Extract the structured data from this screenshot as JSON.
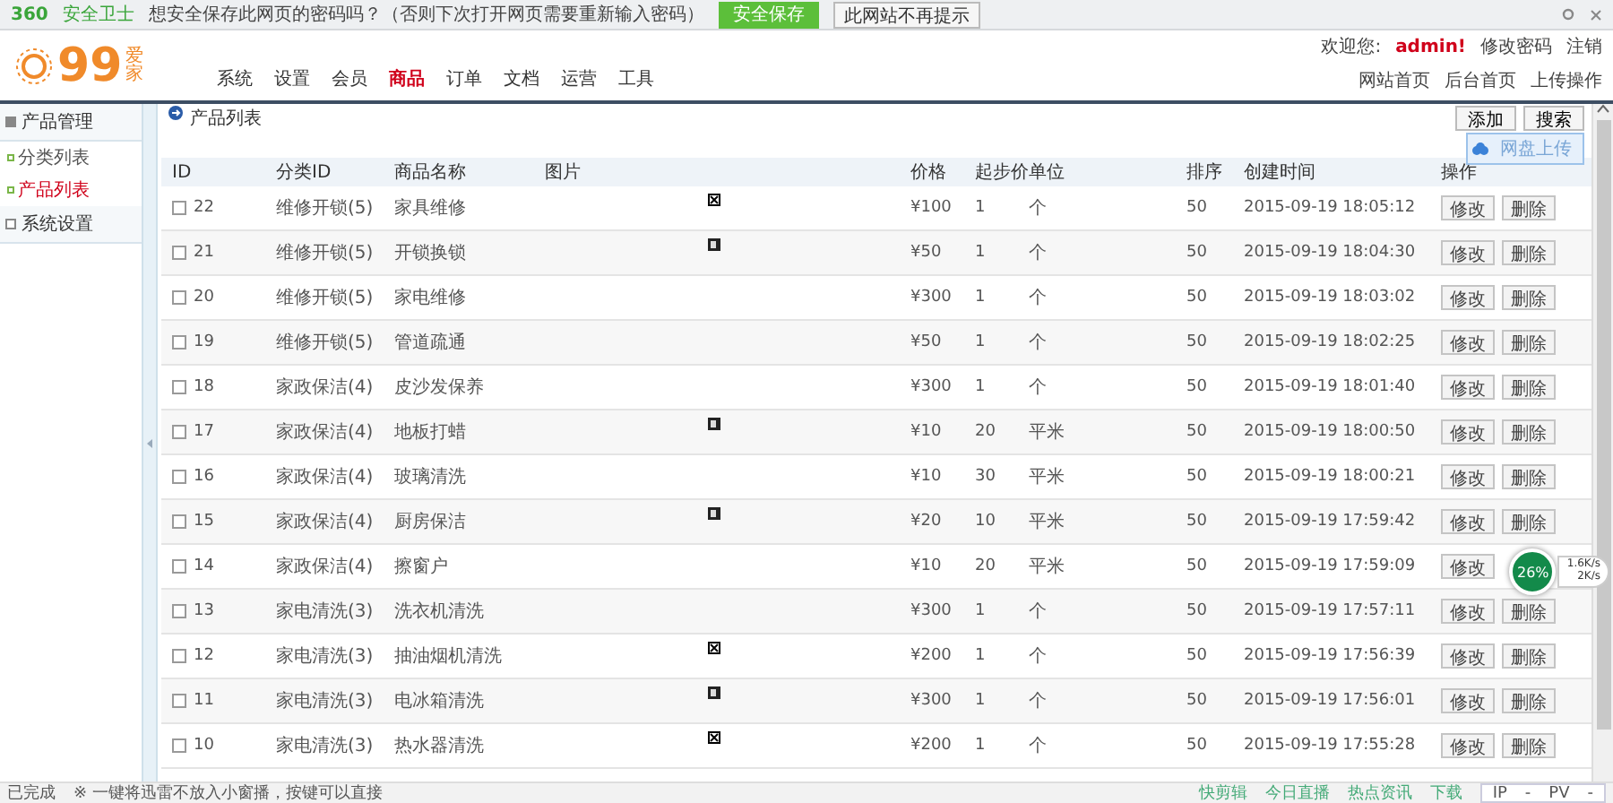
{
  "browser_bar": {
    "logo": "360",
    "logo_sub": "安全卫士",
    "prompt": "想安全保存此网页的密码吗？（否则下次打开网页需要重新输入密码）",
    "save_button": "安全保存",
    "dismiss_button": "此网站不再提示"
  },
  "header": {
    "logo_number": "99",
    "logo_text": "爱家",
    "nav": [
      {
        "label": "系统",
        "selected": false
      },
      {
        "label": "设置",
        "selected": false
      },
      {
        "label": "会员",
        "selected": false
      },
      {
        "label": "商品",
        "selected": true
      },
      {
        "label": "订单",
        "selected": false
      },
      {
        "label": "文档",
        "selected": false
      },
      {
        "label": "运营",
        "selected": false
      },
      {
        "label": "工具",
        "selected": false
      }
    ],
    "welcome": "欢迎您:",
    "user": "admin!",
    "user_links": [
      "修改密码",
      "注销"
    ],
    "quick_links": [
      "网站首页",
      "后台首页",
      "上传操作"
    ]
  },
  "sidebar": {
    "groups": [
      {
        "label": "产品管理",
        "expanded": true,
        "children": [
          {
            "label": "分类列表",
            "selected": false
          },
          {
            "label": "产品列表",
            "selected": true
          }
        ]
      },
      {
        "label": "系统设置",
        "expanded": false
      }
    ]
  },
  "page": {
    "title": "产品列表",
    "buttons": [
      "添加",
      "搜索"
    ],
    "upload_badge": "网盘上传"
  },
  "table": {
    "columns": [
      "ID",
      "分类ID",
      "商品名称",
      "图片",
      "价格",
      "起步价",
      "单位",
      "排序",
      "创建时间",
      "操作"
    ],
    "rows": [
      {
        "id": "22",
        "checked": false,
        "category": "维修开锁(5)",
        "name": "家具维修",
        "image": {
          "kind": "broken"
        },
        "price": "¥100",
        "start": "1",
        "unit": "个",
        "sort": "50",
        "created": "2015-09-19 18:05:12",
        "actions": [
          "修改",
          "删除"
        ]
      },
      {
        "id": "21",
        "checked": false,
        "category": "维修开锁(5)",
        "name": "开锁换锁",
        "image": {
          "kind": "photo"
        },
        "price": "¥50",
        "start": "1",
        "unit": "个",
        "sort": "50",
        "created": "2015-09-19 18:04:30",
        "actions": [
          "修改",
          "删除"
        ]
      },
      {
        "id": "20",
        "checked": false,
        "category": "维修开锁(5)",
        "name": "家电维修",
        "price": "¥300",
        "start": "1",
        "unit": "个",
        "sort": "50",
        "created": "2015-09-19 18:03:02",
        "actions": [
          "修改",
          "删除"
        ]
      },
      {
        "id": "19",
        "checked": false,
        "category": "维修开锁(5)",
        "name": "管道疏通",
        "price": "¥50",
        "start": "1",
        "unit": "个",
        "sort": "50",
        "created": "2015-09-19 18:02:25",
        "actions": [
          "修改",
          "删除"
        ]
      },
      {
        "id": "18",
        "checked": false,
        "category": "家政保洁(4)",
        "name": "皮沙发保养",
        "price": "¥300",
        "start": "1",
        "unit": "个",
        "sort": "50",
        "created": "2015-09-19 18:01:40",
        "actions": [
          "修改",
          "删除"
        ]
      },
      {
        "id": "17",
        "checked": false,
        "category": "家政保洁(4)",
        "name": "地板打蜡",
        "image": {
          "kind": "photo"
        },
        "price": "¥10",
        "start": "20",
        "unit": "平米",
        "sort": "50",
        "created": "2015-09-19 18:00:50",
        "actions": [
          "修改",
          "删除"
        ]
      },
      {
        "id": "16",
        "checked": false,
        "category": "家政保洁(4)",
        "name": "玻璃清洗",
        "price": "¥10",
        "start": "30",
        "unit": "平米",
        "sort": "50",
        "created": "2015-09-19 18:00:21",
        "actions": [
          "修改",
          "删除"
        ]
      },
      {
        "id": "15",
        "checked": false,
        "category": "家政保洁(4)",
        "name": "厨房保洁",
        "image": {
          "kind": "photo"
        },
        "price": "¥20",
        "start": "10",
        "unit": "平米",
        "sort": "50",
        "created": "2015-09-19 17:59:42",
        "actions": [
          "修改",
          "删除"
        ]
      },
      {
        "id": "14",
        "checked": false,
        "category": "家政保洁(4)",
        "name": "擦窗户",
        "price": "¥10",
        "start": "20",
        "unit": "平米",
        "sort": "50",
        "created": "2015-09-19 17:59:09",
        "actions": [
          "修改"
        ]
      },
      {
        "id": "13",
        "checked": false,
        "category": "家电清洗(3)",
        "name": "洗衣机清洗",
        "price": "¥300",
        "start": "1",
        "unit": "个",
        "sort": "50",
        "created": "2015-09-19 17:57:11",
        "actions": [
          "修改",
          "删除"
        ]
      },
      {
        "id": "12",
        "checked": false,
        "category": "家电清洗(3)",
        "name": "抽油烟机清洗",
        "image": {
          "kind": "broken"
        },
        "price": "¥200",
        "start": "1",
        "unit": "个",
        "sort": "50",
        "created": "2015-09-19 17:56:39",
        "actions": [
          "修改",
          "删除"
        ]
      },
      {
        "id": "11",
        "checked": false,
        "category": "家电清洗(3)",
        "name": "电冰箱清洗",
        "image": {
          "kind": "photo"
        },
        "price": "¥300",
        "start": "1",
        "unit": "个",
        "sort": "50",
        "created": "2015-09-19 17:56:01",
        "actions": [
          "修改",
          "删除"
        ]
      },
      {
        "id": "10",
        "checked": false,
        "category": "家电清洗(3)",
        "name": "热水器清洗",
        "image": {
          "kind": "broken"
        },
        "price": "¥200",
        "start": "1",
        "unit": "个",
        "sort": "50",
        "created": "2015-09-19 17:55:28",
        "actions": [
          "修改",
          "删除"
        ]
      }
    ]
  },
  "speed_widget": {
    "percent": "26%",
    "up": "1.6K/s",
    "down": "2K/s"
  },
  "status_bar": {
    "left": "已完成",
    "notice": "※ 一键将迅雷不放入小窗播，按键可以直接",
    "items": [
      "快剪辑",
      "今日直播",
      "热点资讯",
      "下载"
    ],
    "ip": "IP",
    "ip_value": "-",
    "pv": "PV",
    "pv_value": "-"
  }
}
